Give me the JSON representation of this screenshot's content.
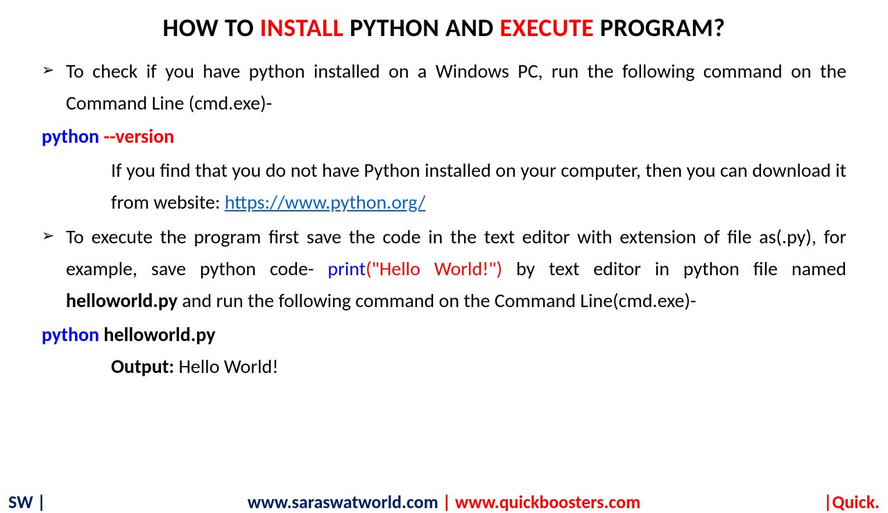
{
  "title": {
    "part1": "HOW TO ",
    "highlight1": "INSTALL",
    "part2": " PYTHON AND ",
    "highlight2": "EXECUTE",
    "part3": " PROGRAM?"
  },
  "bullet1": "To check if you have python installed on a Windows PC, run the following command on the Command Line (cmd.exe)-",
  "cmd1": {
    "python": "python",
    "version": " --version"
  },
  "sub1a": "If you find that you do not have Python installed on your computer, then you can download it from website: ",
  "link": "https://www.python.org/",
  "bullet2a": "To execute the program first save the code in the text editor with extension of file as(.py), for example, save python code- ",
  "bullet2_print": "print",
  "bullet2_args": "(\"Hello World!\")",
  "bullet2b": " by text editor in python file named ",
  "bullet2_filename": "helloworld.py",
  "bullet2c": " and run the following command on the Command Line(cmd.exe)-",
  "cmd2": {
    "python": "python ",
    "file": "helloworld.py"
  },
  "output_label": "Output:",
  "output_value": " Hello World!",
  "footer": {
    "left": "SW |",
    "center_sw": "www.saraswatworld.com",
    "center_sep": " | ",
    "center_qb": "www.quickboosters.com",
    "right": "|Quick."
  }
}
